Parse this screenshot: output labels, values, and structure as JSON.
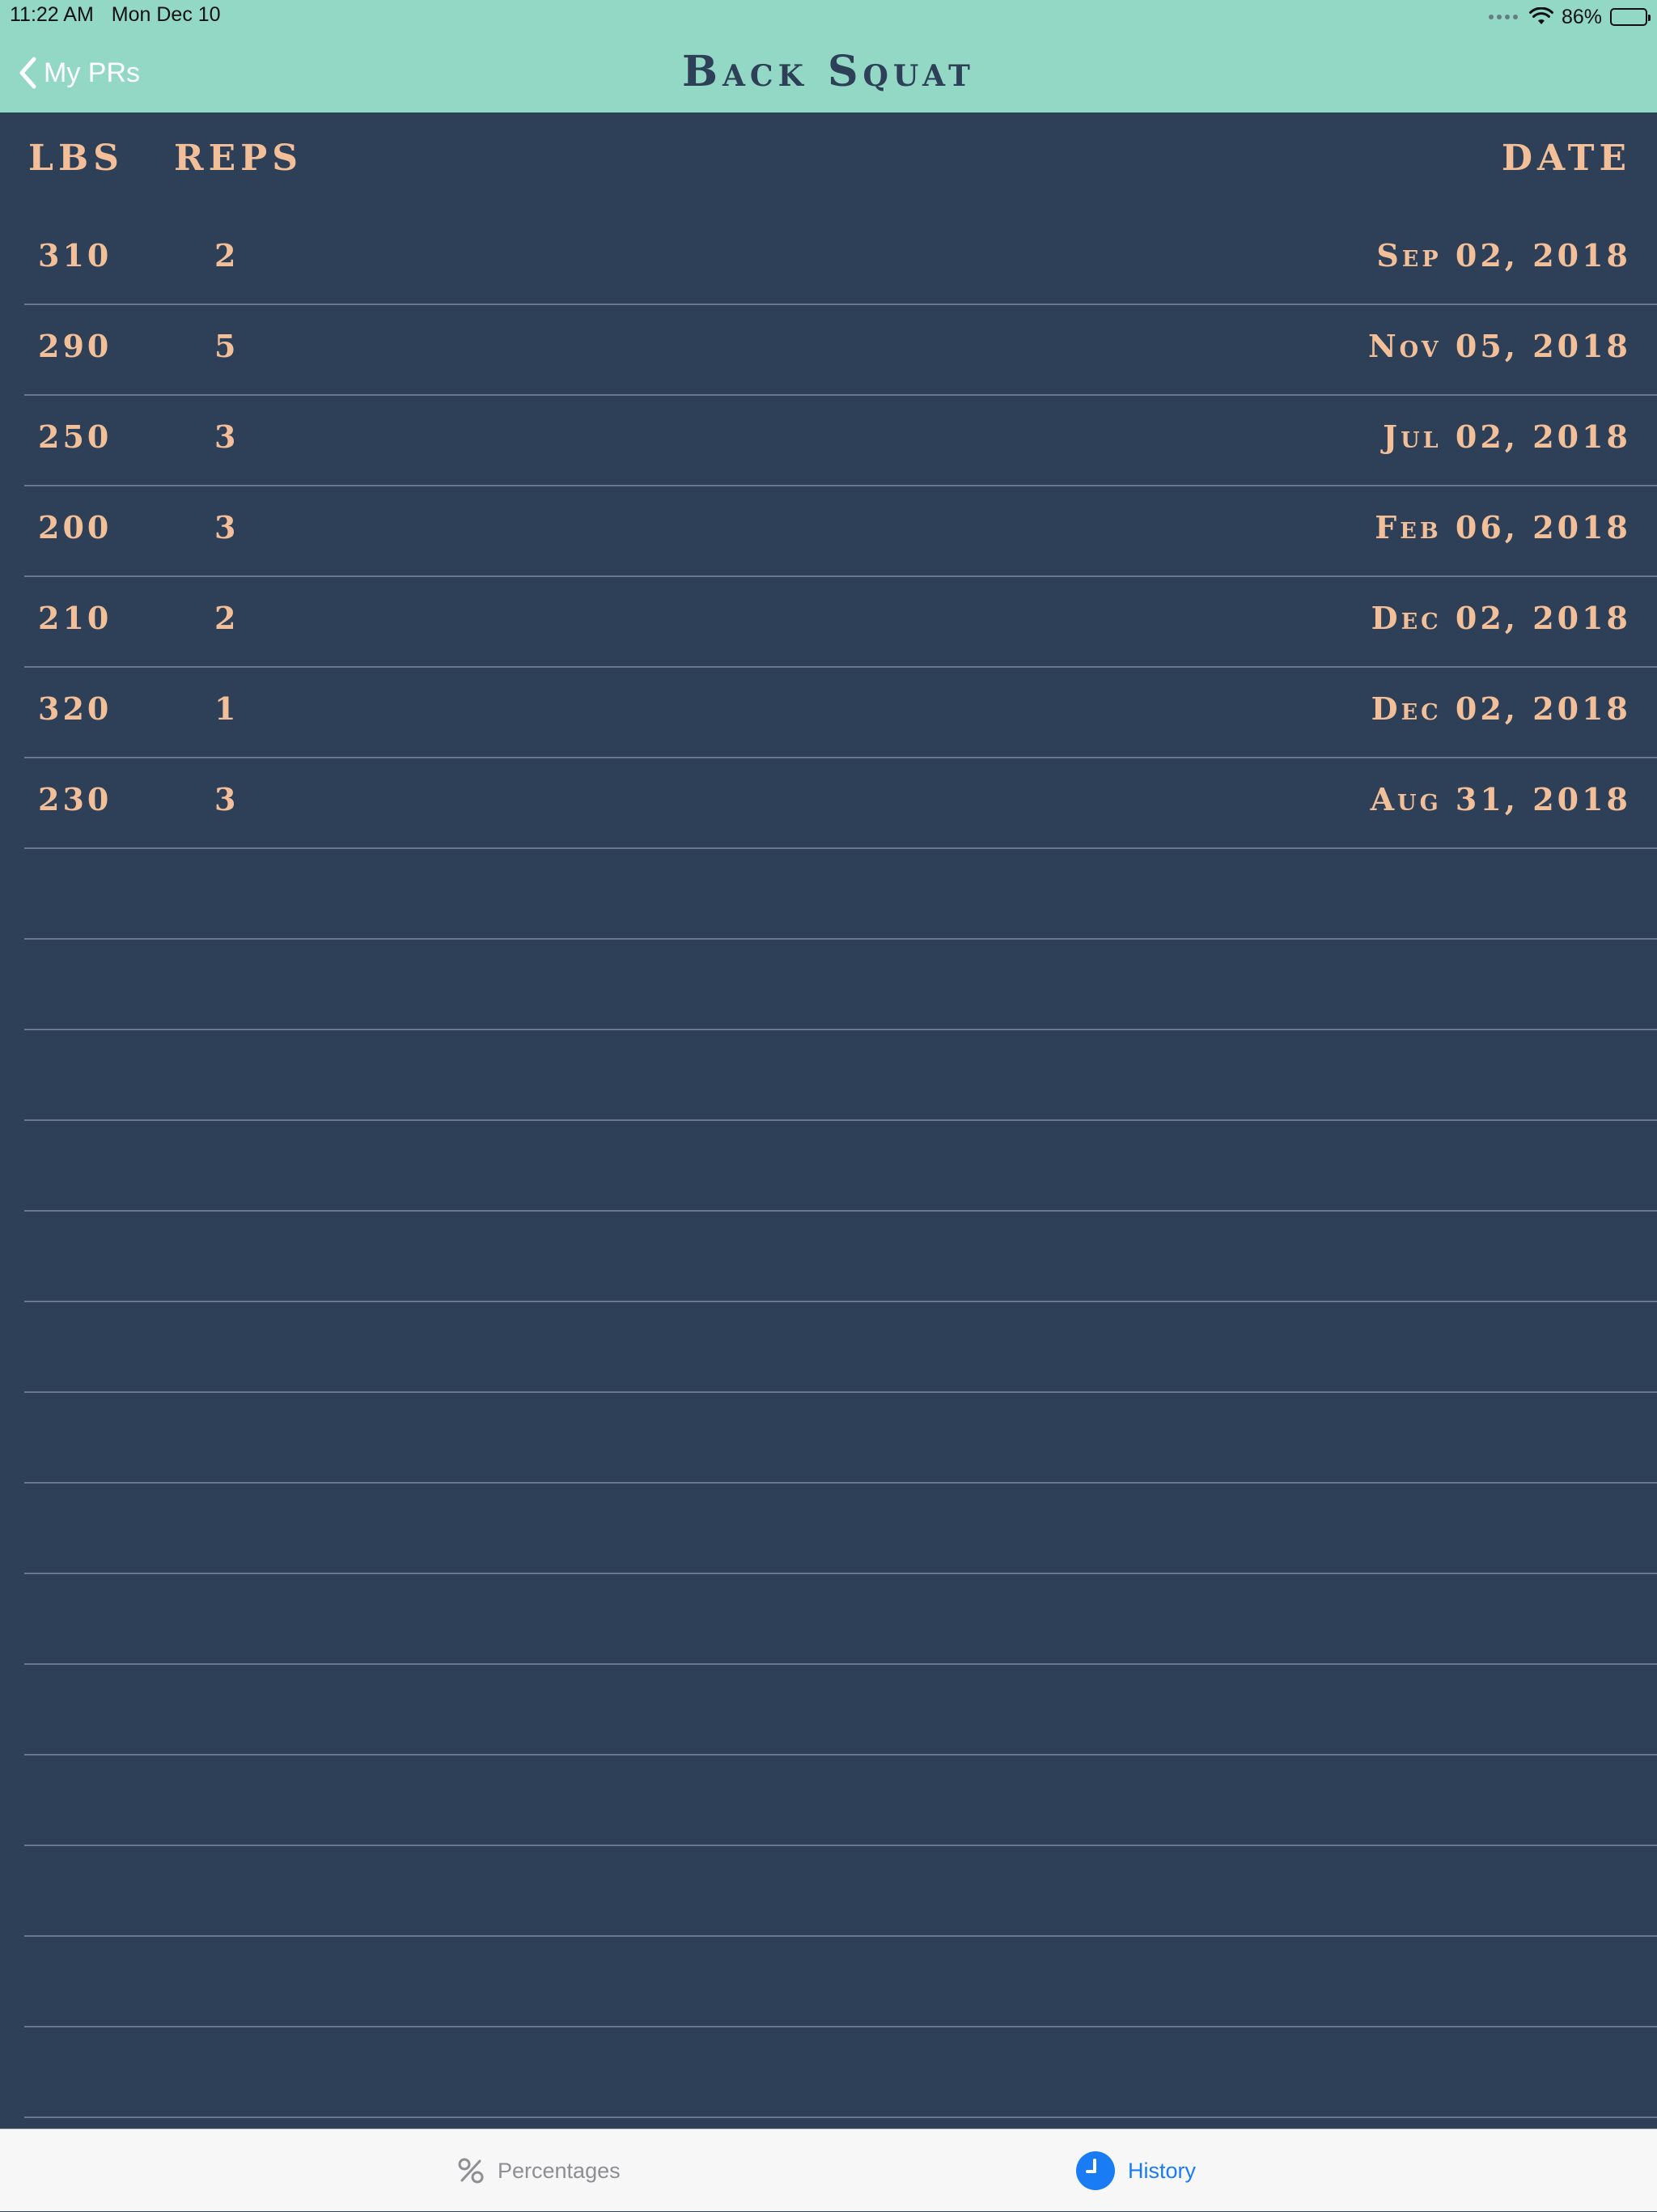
{
  "status_bar": {
    "time": "11:22 AM",
    "date": "Mon Dec 10",
    "battery": "86%",
    "battery_level": 0.86
  },
  "nav": {
    "back_label": "My PRs",
    "title": "Back Squat"
  },
  "columns": {
    "lbs": "LBS",
    "reps": "REPS",
    "date": "DATE"
  },
  "rows": [
    {
      "lbs": "310",
      "reps": "2",
      "date": "Sep 02, 2018"
    },
    {
      "lbs": "290",
      "reps": "5",
      "date": "Nov 05, 2018"
    },
    {
      "lbs": "250",
      "reps": "3",
      "date": "Jul 02, 2018"
    },
    {
      "lbs": "200",
      "reps": "3",
      "date": "Feb 06, 2018"
    },
    {
      "lbs": "210",
      "reps": "2",
      "date": "Dec 02, 2018"
    },
    {
      "lbs": "320",
      "reps": "1",
      "date": "Dec 02, 2018"
    },
    {
      "lbs": "230",
      "reps": "3",
      "date": "Aug 31, 2018"
    }
  ],
  "empty_row_count": 14,
  "tabs": [
    {
      "label": "Percentages",
      "icon": "percent-icon",
      "selected": false
    },
    {
      "label": "History",
      "icon": "clock-icon",
      "selected": true
    }
  ],
  "colors": {
    "header_bg": "#92d8c4",
    "body_bg": "#2e3f58",
    "text_peach": "#f2bf98",
    "tab_selected": "#1a7cf5"
  }
}
